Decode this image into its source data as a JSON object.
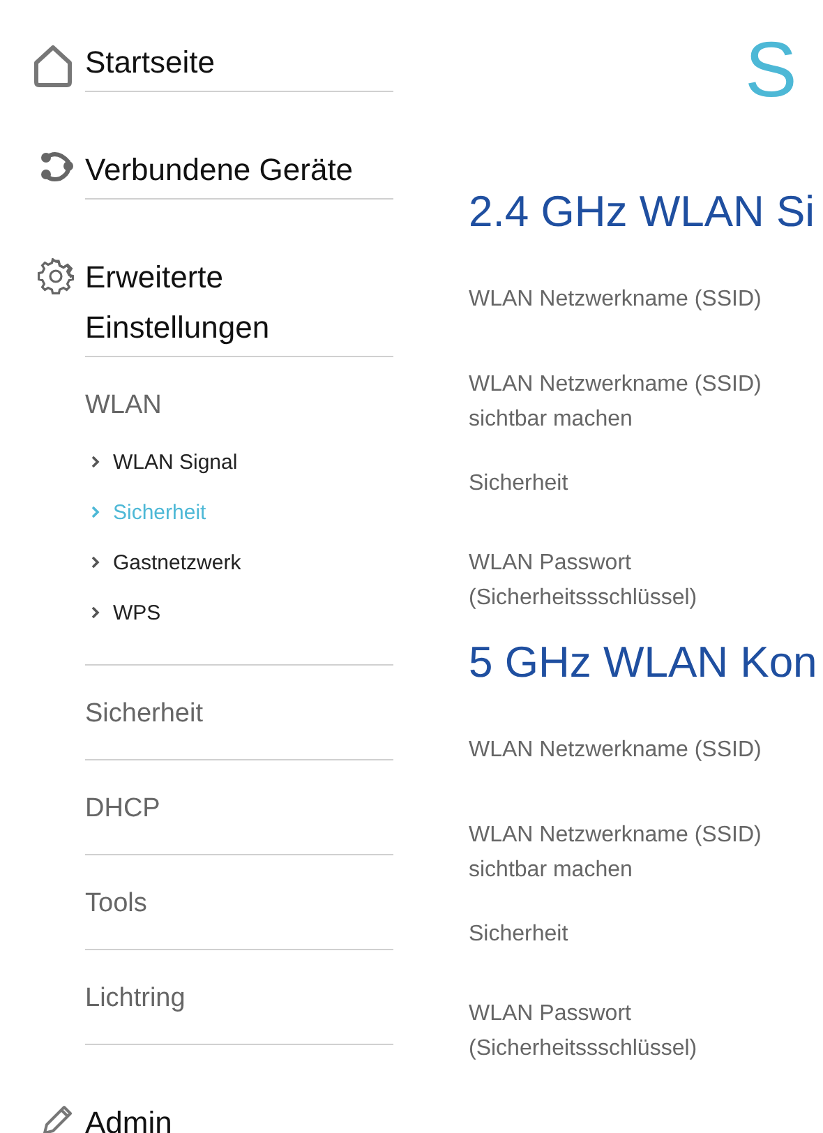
{
  "nav": [
    {
      "label": "Startseite"
    },
    {
      "label": "Verbundene Geräte"
    },
    {
      "label": "Erweiterte Einstellungen",
      "groups": [
        {
          "label": "WLAN",
          "items": [
            {
              "label": "WLAN Signal",
              "selected": false
            },
            {
              "label": "Sicherheit",
              "selected": true
            },
            {
              "label": "Gastnetzwerk",
              "selected": false
            },
            {
              "label": "WPS",
              "selected": false
            }
          ]
        },
        {
          "label": "Sicherheit"
        },
        {
          "label": "DHCP"
        },
        {
          "label": "Tools"
        },
        {
          "label": "Lichtring"
        }
      ]
    },
    {
      "label": "Admin"
    }
  ],
  "page_title": "S",
  "sections": [
    {
      "heading": "2.4 GHz WLAN Si",
      "fields": [
        {
          "label": "WLAN Netzwerkname (SSID)"
        },
        {
          "label": "WLAN Netzwerkname (SSID) sichtbar machen"
        },
        {
          "label": "Sicherheit"
        },
        {
          "label": "WLAN Passwort (Sicherheitssschlüssel)"
        }
      ]
    },
    {
      "heading": "5 GHz WLAN Kon",
      "fields": [
        {
          "label": "WLAN Netzwerkname (SSID)"
        },
        {
          "label": "WLAN Netzwerkname (SSID) sichtbar machen"
        },
        {
          "label": "Sicherheit"
        },
        {
          "label": "WLAN Passwort (Sicherheitssschlüssel)"
        }
      ]
    }
  ]
}
